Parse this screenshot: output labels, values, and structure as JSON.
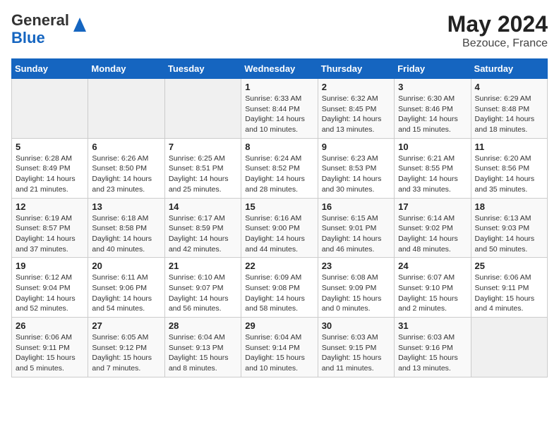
{
  "header": {
    "logo_line1": "General",
    "logo_line2": "Blue",
    "month": "May 2024",
    "location": "Bezouce, France"
  },
  "weekdays": [
    "Sunday",
    "Monday",
    "Tuesday",
    "Wednesday",
    "Thursday",
    "Friday",
    "Saturday"
  ],
  "weeks": [
    [
      {
        "day": "",
        "info": ""
      },
      {
        "day": "",
        "info": ""
      },
      {
        "day": "",
        "info": ""
      },
      {
        "day": "1",
        "info": "Sunrise: 6:33 AM\nSunset: 8:44 PM\nDaylight: 14 hours\nand 10 minutes."
      },
      {
        "day": "2",
        "info": "Sunrise: 6:32 AM\nSunset: 8:45 PM\nDaylight: 14 hours\nand 13 minutes."
      },
      {
        "day": "3",
        "info": "Sunrise: 6:30 AM\nSunset: 8:46 PM\nDaylight: 14 hours\nand 15 minutes."
      },
      {
        "day": "4",
        "info": "Sunrise: 6:29 AM\nSunset: 8:48 PM\nDaylight: 14 hours\nand 18 minutes."
      }
    ],
    [
      {
        "day": "5",
        "info": "Sunrise: 6:28 AM\nSunset: 8:49 PM\nDaylight: 14 hours\nand 21 minutes."
      },
      {
        "day": "6",
        "info": "Sunrise: 6:26 AM\nSunset: 8:50 PM\nDaylight: 14 hours\nand 23 minutes."
      },
      {
        "day": "7",
        "info": "Sunrise: 6:25 AM\nSunset: 8:51 PM\nDaylight: 14 hours\nand 25 minutes."
      },
      {
        "day": "8",
        "info": "Sunrise: 6:24 AM\nSunset: 8:52 PM\nDaylight: 14 hours\nand 28 minutes."
      },
      {
        "day": "9",
        "info": "Sunrise: 6:23 AM\nSunset: 8:53 PM\nDaylight: 14 hours\nand 30 minutes."
      },
      {
        "day": "10",
        "info": "Sunrise: 6:21 AM\nSunset: 8:55 PM\nDaylight: 14 hours\nand 33 minutes."
      },
      {
        "day": "11",
        "info": "Sunrise: 6:20 AM\nSunset: 8:56 PM\nDaylight: 14 hours\nand 35 minutes."
      }
    ],
    [
      {
        "day": "12",
        "info": "Sunrise: 6:19 AM\nSunset: 8:57 PM\nDaylight: 14 hours\nand 37 minutes."
      },
      {
        "day": "13",
        "info": "Sunrise: 6:18 AM\nSunset: 8:58 PM\nDaylight: 14 hours\nand 40 minutes."
      },
      {
        "day": "14",
        "info": "Sunrise: 6:17 AM\nSunset: 8:59 PM\nDaylight: 14 hours\nand 42 minutes."
      },
      {
        "day": "15",
        "info": "Sunrise: 6:16 AM\nSunset: 9:00 PM\nDaylight: 14 hours\nand 44 minutes."
      },
      {
        "day": "16",
        "info": "Sunrise: 6:15 AM\nSunset: 9:01 PM\nDaylight: 14 hours\nand 46 minutes."
      },
      {
        "day": "17",
        "info": "Sunrise: 6:14 AM\nSunset: 9:02 PM\nDaylight: 14 hours\nand 48 minutes."
      },
      {
        "day": "18",
        "info": "Sunrise: 6:13 AM\nSunset: 9:03 PM\nDaylight: 14 hours\nand 50 minutes."
      }
    ],
    [
      {
        "day": "19",
        "info": "Sunrise: 6:12 AM\nSunset: 9:04 PM\nDaylight: 14 hours\nand 52 minutes."
      },
      {
        "day": "20",
        "info": "Sunrise: 6:11 AM\nSunset: 9:06 PM\nDaylight: 14 hours\nand 54 minutes."
      },
      {
        "day": "21",
        "info": "Sunrise: 6:10 AM\nSunset: 9:07 PM\nDaylight: 14 hours\nand 56 minutes."
      },
      {
        "day": "22",
        "info": "Sunrise: 6:09 AM\nSunset: 9:08 PM\nDaylight: 14 hours\nand 58 minutes."
      },
      {
        "day": "23",
        "info": "Sunrise: 6:08 AM\nSunset: 9:09 PM\nDaylight: 15 hours\nand 0 minutes."
      },
      {
        "day": "24",
        "info": "Sunrise: 6:07 AM\nSunset: 9:10 PM\nDaylight: 15 hours\nand 2 minutes."
      },
      {
        "day": "25",
        "info": "Sunrise: 6:06 AM\nSunset: 9:11 PM\nDaylight: 15 hours\nand 4 minutes."
      }
    ],
    [
      {
        "day": "26",
        "info": "Sunrise: 6:06 AM\nSunset: 9:11 PM\nDaylight: 15 hours\nand 5 minutes."
      },
      {
        "day": "27",
        "info": "Sunrise: 6:05 AM\nSunset: 9:12 PM\nDaylight: 15 hours\nand 7 minutes."
      },
      {
        "day": "28",
        "info": "Sunrise: 6:04 AM\nSunset: 9:13 PM\nDaylight: 15 hours\nand 8 minutes."
      },
      {
        "day": "29",
        "info": "Sunrise: 6:04 AM\nSunset: 9:14 PM\nDaylight: 15 hours\nand 10 minutes."
      },
      {
        "day": "30",
        "info": "Sunrise: 6:03 AM\nSunset: 9:15 PM\nDaylight: 15 hours\nand 11 minutes."
      },
      {
        "day": "31",
        "info": "Sunrise: 6:03 AM\nSunset: 9:16 PM\nDaylight: 15 hours\nand 13 minutes."
      },
      {
        "day": "",
        "info": ""
      }
    ]
  ]
}
